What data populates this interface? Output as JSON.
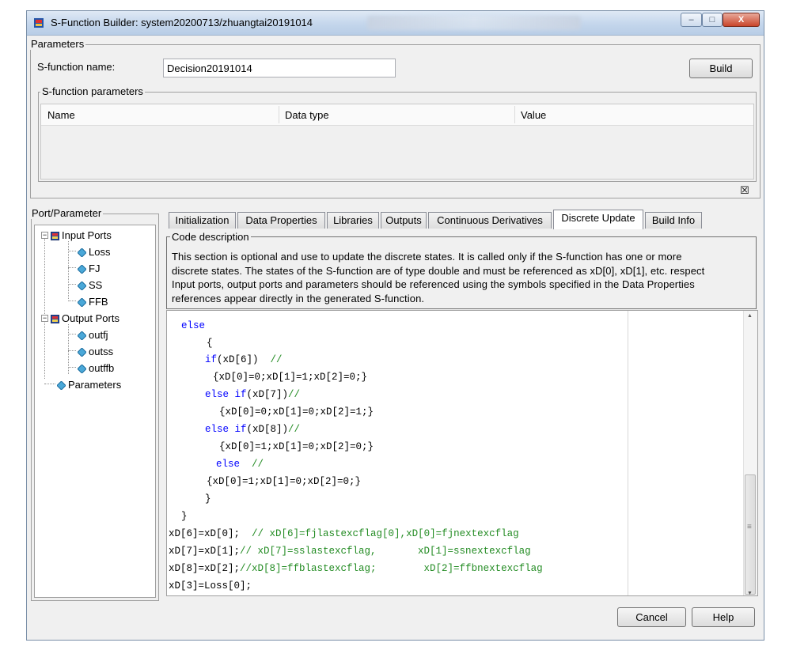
{
  "window": {
    "title": "S-Function Builder: system20200713/zhuangtai20191014",
    "minimize_glyph": "–",
    "maximize_glyph": "□",
    "close_glyph": "X"
  },
  "parameters": {
    "legend": "Parameters",
    "sfunction_name_label": "S-function name:",
    "sfunction_name_value": "Decision20191014",
    "build_label": "Build",
    "sfunction_params_legend": "S-function parameters",
    "columns": [
      "Name",
      "Data type",
      "Value"
    ],
    "undock_glyph": "☒"
  },
  "port_parameter": {
    "legend": "Port/Parameter",
    "input_ports_label": "Input Ports",
    "inputs": [
      "Loss",
      "FJ",
      "SS",
      "FFB"
    ],
    "output_ports_label": "Output Ports",
    "outputs": [
      "outfj",
      "outss",
      "outffb"
    ],
    "parameters_label": "Parameters"
  },
  "tabs": [
    {
      "label": "Initialization",
      "active": false
    },
    {
      "label": "Data Properties",
      "active": false
    },
    {
      "label": "Libraries",
      "active": false
    },
    {
      "label": "Outputs",
      "active": false
    },
    {
      "label": "Continuous Derivatives",
      "active": false
    },
    {
      "label": "Discrete Update",
      "active": true
    },
    {
      "label": "Build Info",
      "active": false
    }
  ],
  "code_description": {
    "legend": "Code description",
    "lines": [
      "This section is optional and use to update the discrete states. It is called only if the S-function has one or more",
      "discrete states. The states of the S-function are of type double and must be referenced as xD[0], xD[1], etc. respect",
      "Input ports, output ports and parameters should be referenced using the symbols specified in the Data Properties",
      "references appear directly in the generated S-function."
    ]
  },
  "code": {
    "else_1": "else",
    "brace_open": "{",
    "if_kw": "if",
    "if_cond": "(xD[6])",
    "if_comment": "//",
    "if_body": "{xD[0]=0;xD[1]=1;xD[2]=0;}",
    "elseif1_kw": "else if",
    "elseif1_cond": "(xD[7])",
    "elseif1_comment": "//",
    "elseif1_body": "{xD[0]=0;xD[1]=0;xD[2]=1;}",
    "elseif2_kw": "else if",
    "elseif2_cond": "(xD[8])",
    "elseif2_comment": "//",
    "elseif2_body": "{xD[0]=1;xD[1]=0;xD[2]=0;}",
    "else_2_kw": "else",
    "else_2_comment": "//",
    "else_body": "{xD[0]=1;xD[1]=0;xD[2]=0;}",
    "brace_close_inner": "}",
    "brace_close_outer": "}",
    "assign1": "xD[6]=xD[0];",
    "assign1_comment": "// xD[6]=fjlastexcflag[0],xD[0]=fjnextexcflag",
    "assign2": "xD[7]=xD[1];",
    "assign2_comment": "// xD[7]=sslastexcflag,       xD[1]=ssnextexcflag",
    "assign3": "xD[8]=xD[2];",
    "assign3_comment": "//xD[8]=ffblastexcflag;        xD[2]=ffbnextexcflag",
    "assign4": "xD[3]=Loss[0];"
  },
  "scroll_glyphs": {
    "up": "▲",
    "down": "▼",
    "grip": "≡"
  },
  "footer": {
    "cancel_label": "Cancel",
    "help_label": "Help"
  }
}
